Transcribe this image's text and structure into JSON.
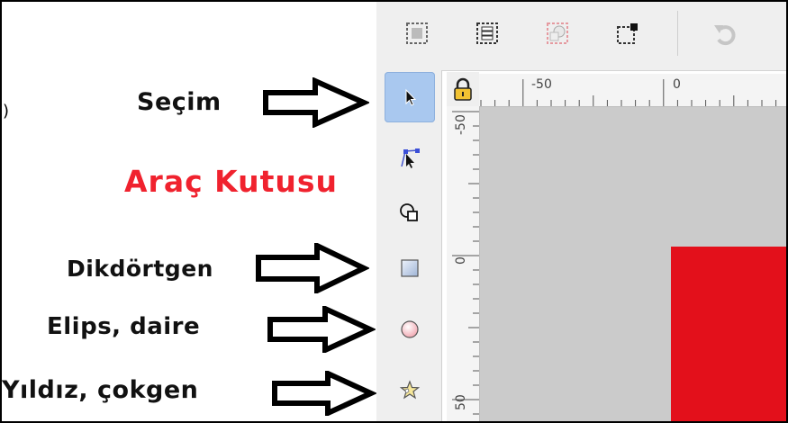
{
  "annotations": {
    "paren": ")",
    "secim": "Seçim",
    "title": "Araç Kutusu",
    "dikdortgen": "Dikdörtgen",
    "elips": "Elips, daire",
    "yildiz": "Yıldız, çokgen"
  },
  "colors": {
    "title_red": "#f0222e",
    "shape_red": "#e3101b",
    "canvas_gray": "#cbcbcb",
    "active_tool": "#a9c8ef"
  },
  "top_toolbar": {
    "buttons": [
      "select-all-icon",
      "select-in-all-layers-icon",
      "deselect-icon",
      "touch-select-icon",
      "undo-icon"
    ]
  },
  "toolbox": {
    "tools": [
      {
        "name": "selector-tool",
        "icon": "arrow-cursor-icon",
        "active": true
      },
      {
        "name": "node-tool",
        "icon": "node-editor-icon",
        "active": false
      },
      {
        "name": "tweak-tool",
        "icon": "shapes-icon",
        "active": false
      },
      {
        "name": "rectangle-tool",
        "icon": "rectangle-icon",
        "active": false
      },
      {
        "name": "ellipse-tool",
        "icon": "circle-icon",
        "active": false
      },
      {
        "name": "star-tool",
        "icon": "star-icon",
        "active": false
      }
    ]
  },
  "rulers": {
    "horizontal": [
      "-50",
      "0"
    ],
    "vertical": [
      "-50",
      "0",
      "50"
    ]
  }
}
